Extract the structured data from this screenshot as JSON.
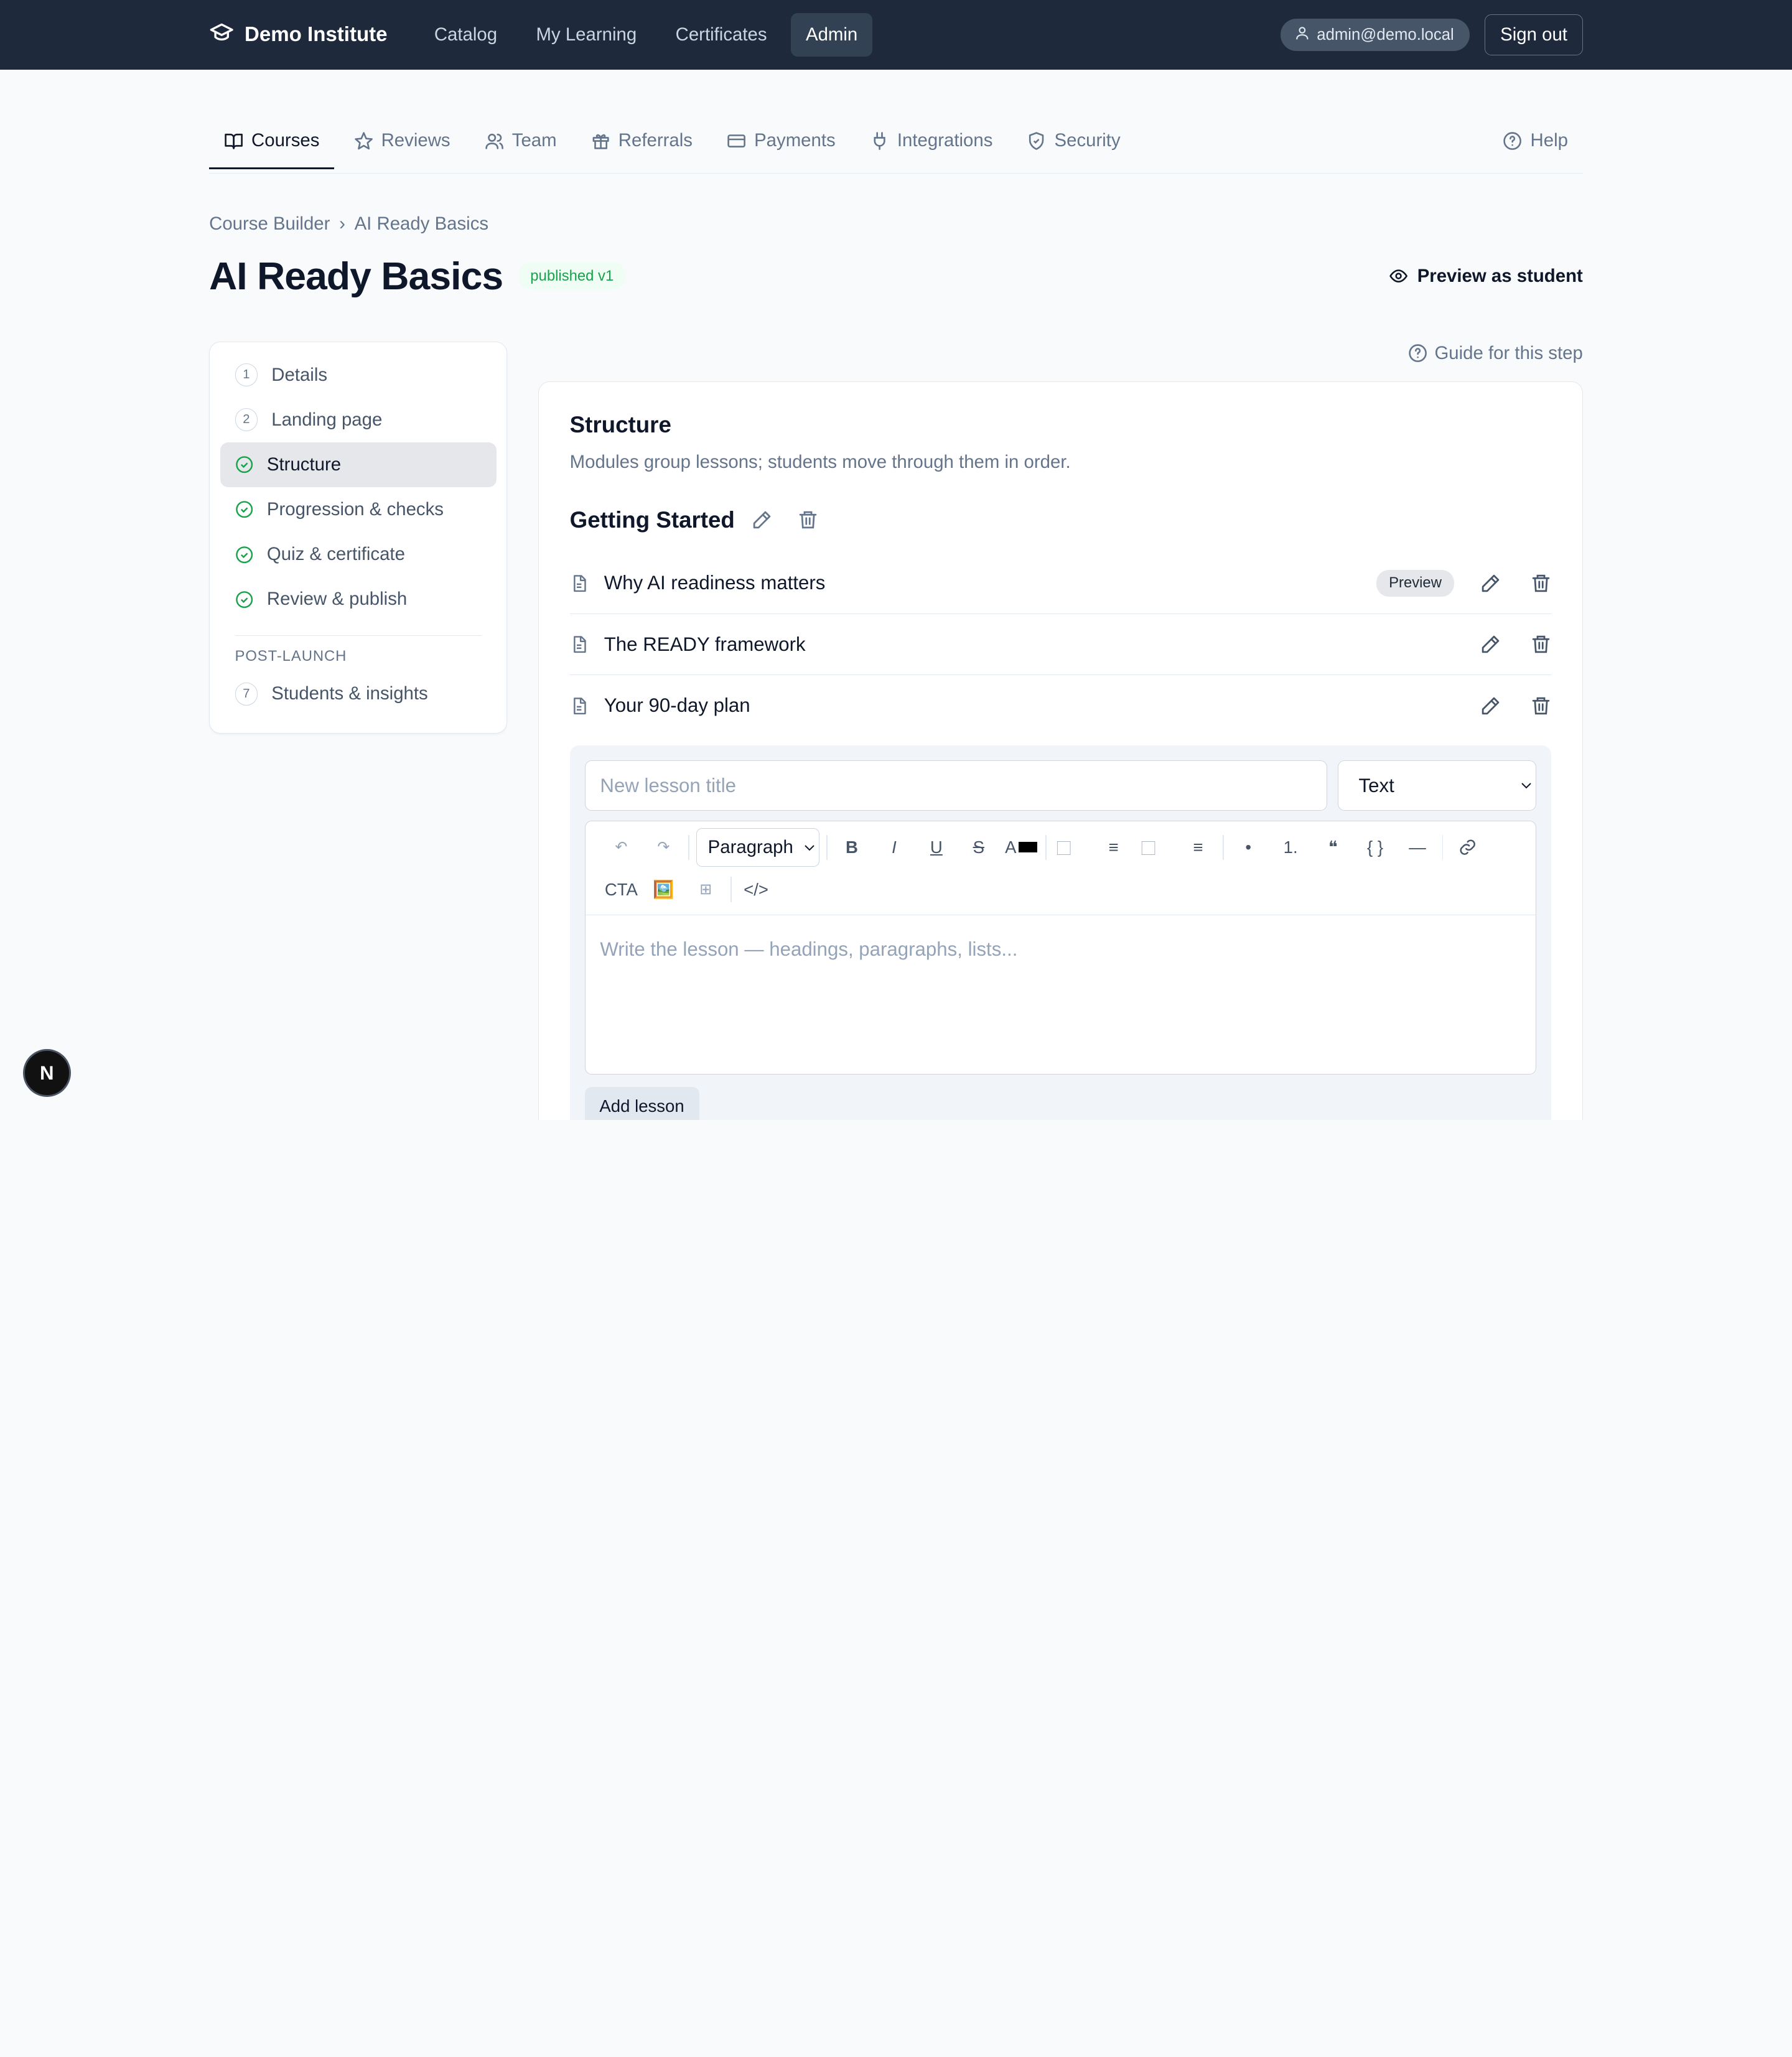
{
  "brand": {
    "name": "Demo Institute",
    "icon": "graduation-cap-icon"
  },
  "topnav": [
    {
      "label": "Catalog"
    },
    {
      "label": "My Learning"
    },
    {
      "label": "Certificates"
    },
    {
      "label": "Admin",
      "active": true
    }
  ],
  "user": {
    "email": "admin@demo.local",
    "signout": "Sign out"
  },
  "tabs": [
    {
      "label": "Courses",
      "icon": "book-icon",
      "active": true
    },
    {
      "label": "Reviews",
      "icon": "star-icon"
    },
    {
      "label": "Team",
      "icon": "users-icon"
    },
    {
      "label": "Referrals",
      "icon": "gift-icon"
    },
    {
      "label": "Payments",
      "icon": "credit-card-icon"
    },
    {
      "label": "Integrations",
      "icon": "plug-icon"
    },
    {
      "label": "Security",
      "icon": "shield-icon"
    }
  ],
  "help_label": "Help",
  "breadcrumb": {
    "root": "Course Builder",
    "sep": "›",
    "current": "AI Ready Basics"
  },
  "page": {
    "title": "AI Ready Basics",
    "status": "published v1",
    "preview": "Preview as student"
  },
  "steps": [
    {
      "num": "1",
      "label": "Details",
      "state": "todo"
    },
    {
      "num": "2",
      "label": "Landing page",
      "state": "todo"
    },
    {
      "label": "Structure",
      "state": "done",
      "active": true
    },
    {
      "label": "Progression & checks",
      "state": "done"
    },
    {
      "label": "Quiz & certificate",
      "state": "done"
    },
    {
      "label": "Review & publish",
      "state": "done"
    }
  ],
  "post_launch": {
    "heading": "POST-LAUNCH",
    "num": "7",
    "label": "Students & insights"
  },
  "guide_label": "Guide for this step",
  "structure": {
    "title": "Structure",
    "subtitle": "Modules group lessons; students move through them in order.",
    "module_title": "Getting Started",
    "lessons": [
      {
        "title": "Why AI readiness matters",
        "badge": "Preview"
      },
      {
        "title": "The READY framework"
      },
      {
        "title": "Your 90-day plan"
      }
    ]
  },
  "new_lesson": {
    "title_placeholder": "New lesson title",
    "type_value": "Text",
    "block_format": "Paragraph",
    "toolbar": {
      "undo": "↶",
      "redo": "↷",
      "bold": "B",
      "italic": "I",
      "underline": "U",
      "strike": "S",
      "text_color": "A",
      "text_color_value": "#000000",
      "align_left": "⃞",
      "align_center": "≡",
      "align_right": "⃞",
      "justify": "≡",
      "bullet": "•",
      "numbered": "1.",
      "quote": "❝",
      "code": "{ }",
      "hr": "—",
      "link": "link-icon",
      "cta": "CTA",
      "image": "🖼️",
      "table": "⊞",
      "html": "</>"
    },
    "body_placeholder": "Write the lesson — headings, paragraphs, lists...",
    "add_button": "Add lesson"
  },
  "fab_label": "N"
}
